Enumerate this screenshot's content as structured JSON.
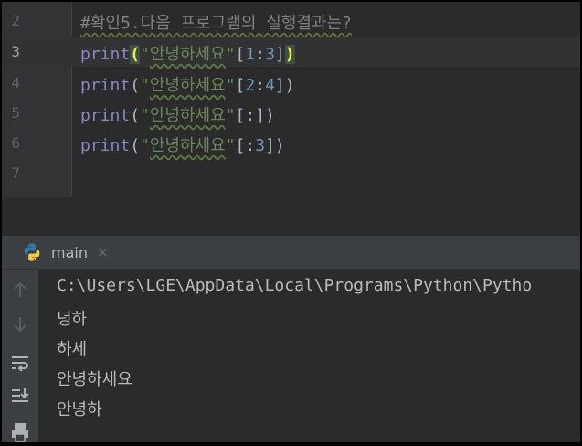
{
  "editor": {
    "lines": [
      {
        "num": "2",
        "comment": "#확인5.다음 프로그램의 실행결과는?"
      },
      {
        "num": "3",
        "fn": "print",
        "open": "(",
        "quote_open": "\"",
        "str": "안녕하세요",
        "quote_close": "\"",
        "slice_open": "[",
        "slice_a": "1",
        "colon": ":",
        "slice_b": "3",
        "slice_close": "]",
        "close": ")"
      },
      {
        "num": "4",
        "fn": "print",
        "open": "(",
        "quote_open": "\"",
        "str": "안녕하세요",
        "quote_close": "\"",
        "slice_open": "[",
        "slice_a": "2",
        "colon": ":",
        "slice_b": "4",
        "slice_close": "]",
        "close": ")"
      },
      {
        "num": "5",
        "fn": "print",
        "open": "(",
        "quote_open": "\"",
        "str": "안녕하세요",
        "quote_close": "\"",
        "slice": "[:]",
        "close": ")"
      },
      {
        "num": "6",
        "fn": "print",
        "open": "(",
        "quote_open": "\"",
        "str": "안녕하세요",
        "quote_close": "\"",
        "slice_open": "[:",
        "slice_b": "3",
        "slice_close": "]",
        "close": ")"
      },
      {
        "num": "7"
      }
    ]
  },
  "run_panel": {
    "tab_label": "main",
    "tab_close": "×",
    "icons": [
      "python-icon",
      "scroll-up-icon",
      "scroll-down-icon",
      "soft-wrap-icon",
      "scroll-to-end-icon",
      "print-icon"
    ],
    "output": [
      "C:\\Users\\LGE\\AppData\\Local\\Programs\\Python\\Pytho",
      "녕하",
      "하세",
      "안녕하세요",
      "안녕하"
    ]
  },
  "colors": {
    "editor_bg": "#2b2b2b",
    "gutter_bg": "#313335",
    "current_line_bg": "#323232",
    "keyword": "#8888c6",
    "string": "#6a8759",
    "number": "#6897bb",
    "comment": "#808080",
    "bracket_match": "#ffef28",
    "panel_bg": "#3c3f41",
    "console_text": "#bbbbbb"
  }
}
